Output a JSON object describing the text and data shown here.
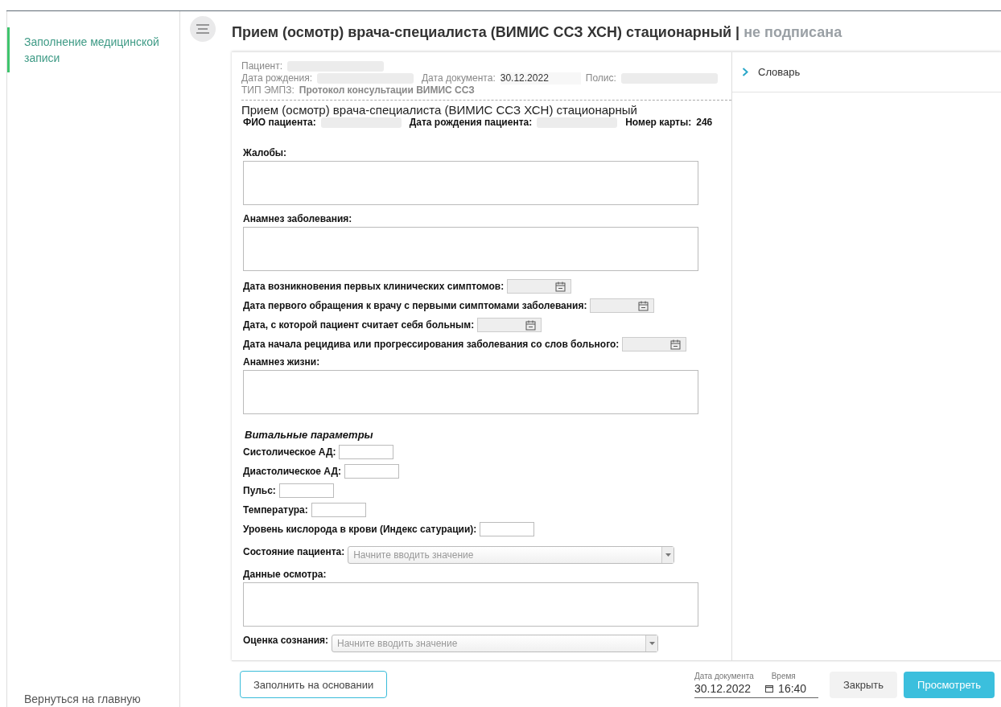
{
  "sidebar": {
    "items": [
      {
        "label": "Заполнение медицинской записи",
        "selected": true
      }
    ],
    "back_link": "Вернуться на главную"
  },
  "header": {
    "title": "Прием (осмотр) врача-специалиста (ВИМИС ССЗ ХСН) стационарный",
    "separator": "|",
    "status": "не подписана"
  },
  "document": {
    "meta_lines": [
      [
        {
          "label": "Пациент:",
          "redacted": true
        }
      ],
      [
        {
          "label": "Дата рождения:",
          "redacted": true
        },
        {
          "label": "Дата документа:",
          "value": "30.12.2022",
          "redacted": false
        },
        {
          "label": "Полис:",
          "redacted": true
        }
      ],
      [
        {
          "label": "ТИП ЭМПЗ:",
          "value": "Протокол консультации ВИМИС ССЗ",
          "redacted": false
        }
      ]
    ],
    "form_title": "Прием (осмотр) врача-специалиста (ВИМИС ССЗ ХСН) стационарный",
    "patient_line": [
      {
        "label": "ФИО пациента:",
        "redacted": true
      },
      {
        "label": "Дата рождения пациента:",
        "redacted": true
      },
      {
        "label": "Номер карты:",
        "value": "246",
        "redacted": false
      }
    ],
    "fields": [
      {
        "kind": "textarea",
        "label": "Жалобы:"
      },
      {
        "kind": "textarea",
        "label": "Анамнез заболевания:"
      },
      {
        "kind": "date",
        "label": "Дата возникновения первых клинических симптомов:"
      },
      {
        "kind": "date",
        "label": "Дата первого обращения к врачу с первыми симптомами заболевания:"
      },
      {
        "kind": "date",
        "label": "Дата, с которой пациент считает себя больным:"
      },
      {
        "kind": "date",
        "label": "Дата начала рецидива или прогрессирования заболевания со слов больного:"
      },
      {
        "kind": "textarea",
        "label": "Анамнез жизни:"
      },
      {
        "kind": "heading",
        "label": "Витальные параметры"
      },
      {
        "kind": "text",
        "label": "Систолическое АД:"
      },
      {
        "kind": "text",
        "label": "Диастолическое АД:"
      },
      {
        "kind": "text",
        "label": "Пульс:"
      },
      {
        "kind": "text",
        "label": "Температура:"
      },
      {
        "kind": "text",
        "label": "Уровень кислорода в крови (Индекс сатурации):"
      },
      {
        "kind": "select",
        "label": "Состояние пациента:",
        "placeholder": "Начните вводить значение"
      },
      {
        "kind": "textarea",
        "label": "Данные осмотра:"
      },
      {
        "kind": "select",
        "label": "Оценка сознания:",
        "placeholder": "Начните вводить значение"
      }
    ]
  },
  "side_panel": {
    "sections": [
      {
        "label": "Словарь",
        "expanded": false
      }
    ]
  },
  "footer": {
    "fill_button": "Заполнить на основании",
    "date": {
      "label": "Дата документа",
      "value": "30.12.2022"
    },
    "time": {
      "label": "Время",
      "value": "16:40"
    },
    "close_button": "Закрыть",
    "view_button": "Просмотреть"
  }
}
